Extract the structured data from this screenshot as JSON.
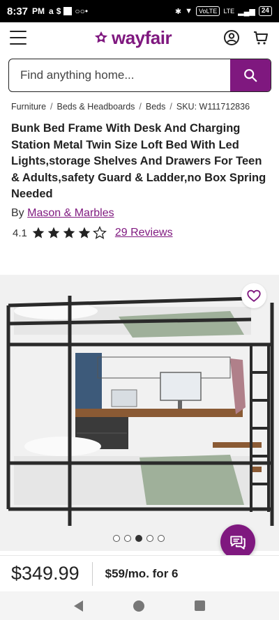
{
  "status_bar": {
    "time": "8:37",
    "ampm": "PM",
    "volte": "VoLTE",
    "lte": "LTE",
    "battery": "24"
  },
  "header": {
    "brand": "wayfair",
    "brand_color": "#7f187f"
  },
  "search": {
    "placeholder": "Find anything home..."
  },
  "breadcrumb": {
    "items": [
      "Furniture",
      "Beds & Headboards",
      "Beds"
    ],
    "separator": "/",
    "sku": "SKU: W111712836"
  },
  "product": {
    "title": "Bunk Bed Frame With Desk And Charging Station Metal Twin Size Loft Bed With Led Lights,storage Shelves And Drawers For Teen & Adults,safety Guard & Ladder,no Box Spring Needed",
    "by_label": "By",
    "brand": "Mason & Marbles",
    "rating": "4.1",
    "rating_value": 4.1,
    "rating_max": 5,
    "reviews_label": "29 Reviews",
    "image_count": 5,
    "active_image": 3
  },
  "pricing": {
    "price": "$349.99",
    "monthly": "$59/mo. for 6"
  }
}
